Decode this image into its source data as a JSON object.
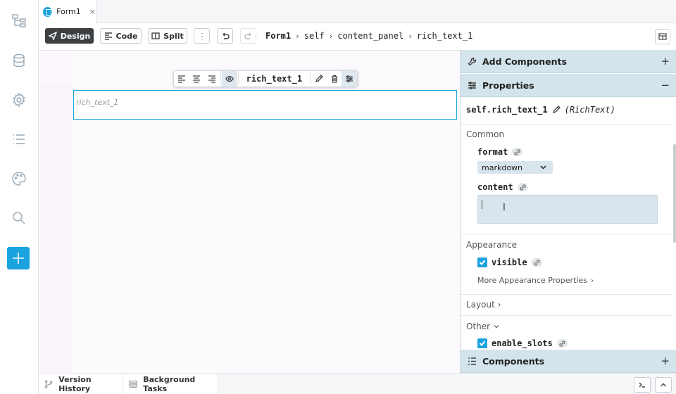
{
  "rail": {
    "icons": [
      "app-structure-icon",
      "data-icon",
      "settings-icon",
      "list-icon",
      "theme-icon",
      "search-icon",
      "add-icon"
    ]
  },
  "tab": {
    "label": "Form1",
    "close": "×"
  },
  "toolbar": {
    "design_label": "Design",
    "code_label": "Code",
    "split_label": "Split",
    "breadcrumb": [
      "Form1",
      "self",
      "content_panel",
      "rich_text_1"
    ]
  },
  "canvas": {
    "component_name": "rich_text_1",
    "placeholder": "rich_text_1"
  },
  "panel": {
    "add_components": "Add Components",
    "properties": "Properties",
    "object_path": "self.rich_text_1",
    "object_type": "(RichText)",
    "common": "Common",
    "format_label": "format",
    "format_value": "markdown",
    "content_label": "content",
    "appearance": "Appearance",
    "visible_label": "visible",
    "more_appearance": "More Appearance Properties",
    "layout": "Layout",
    "other": "Other",
    "enable_slots_label": "enable_slots",
    "components": "Components",
    "plus": "+",
    "minus": "−"
  },
  "footer": {
    "version_history": "Version History",
    "background_tasks": "Background Tasks"
  },
  "colors": {
    "accent": "#1aa3df",
    "panel_header": "#d4e4ec",
    "design_active": "#3c4043"
  }
}
